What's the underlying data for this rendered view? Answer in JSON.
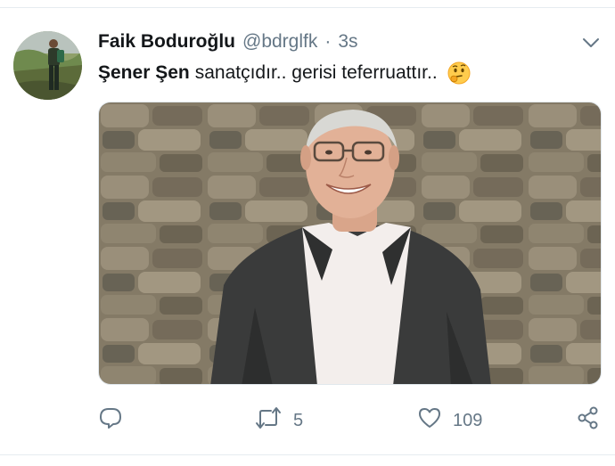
{
  "tweet": {
    "display_name": "Faik Boduroğlu",
    "handle": "@bdrglfk",
    "separator": "·",
    "time": "3s",
    "text_bold": "Şener Şen",
    "text_rest": "sanatçıdır.. gerisi teferruattır..",
    "emoji": "thinking-face-emoji",
    "media_alt": "Photo of a smiling man with glasses and grey hair in a dark blazer in front of a stone wall"
  },
  "actions": {
    "reply_icon": "reply-icon",
    "retweet_icon": "retweet-icon",
    "retweet_count": "5",
    "like_icon": "heart-icon",
    "like_count": "109",
    "share_icon": "share-icon"
  },
  "colors": {
    "text": "#14171a",
    "secondary": "#657786",
    "divider": "#e6ecf0"
  }
}
